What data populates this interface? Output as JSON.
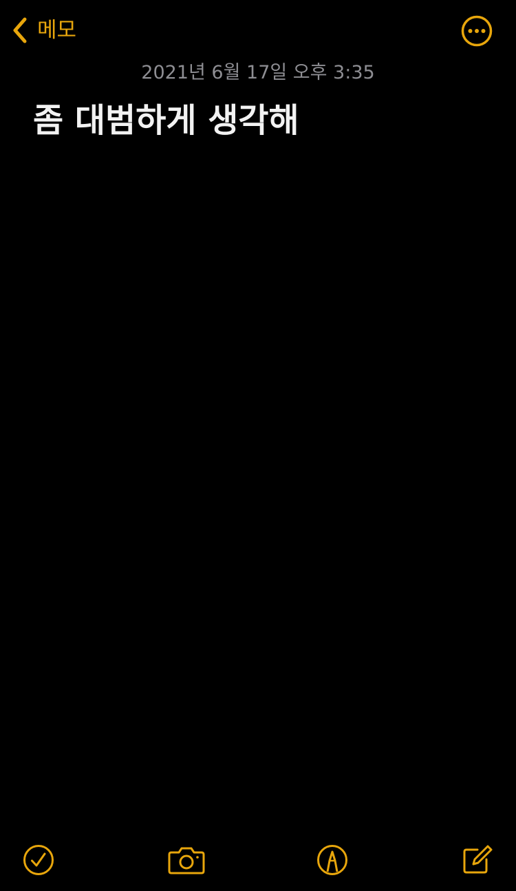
{
  "header": {
    "back_label": "메모",
    "back_icon": "chevron-left-icon",
    "more_icon": "ellipsis-circle-icon"
  },
  "note": {
    "date": "2021년 6월 17일 오후 3:35",
    "title": "좀 대범하게 생각해"
  },
  "toolbar": {
    "items": [
      {
        "icon": "checklist-icon"
      },
      {
        "icon": "camera-icon"
      },
      {
        "icon": "markup-pen-icon"
      },
      {
        "icon": "compose-icon"
      }
    ]
  },
  "colors": {
    "accent": "#E8A60C",
    "background": "#000000",
    "date_text": "#8e8e93",
    "title_text": "#f2f2f2"
  }
}
